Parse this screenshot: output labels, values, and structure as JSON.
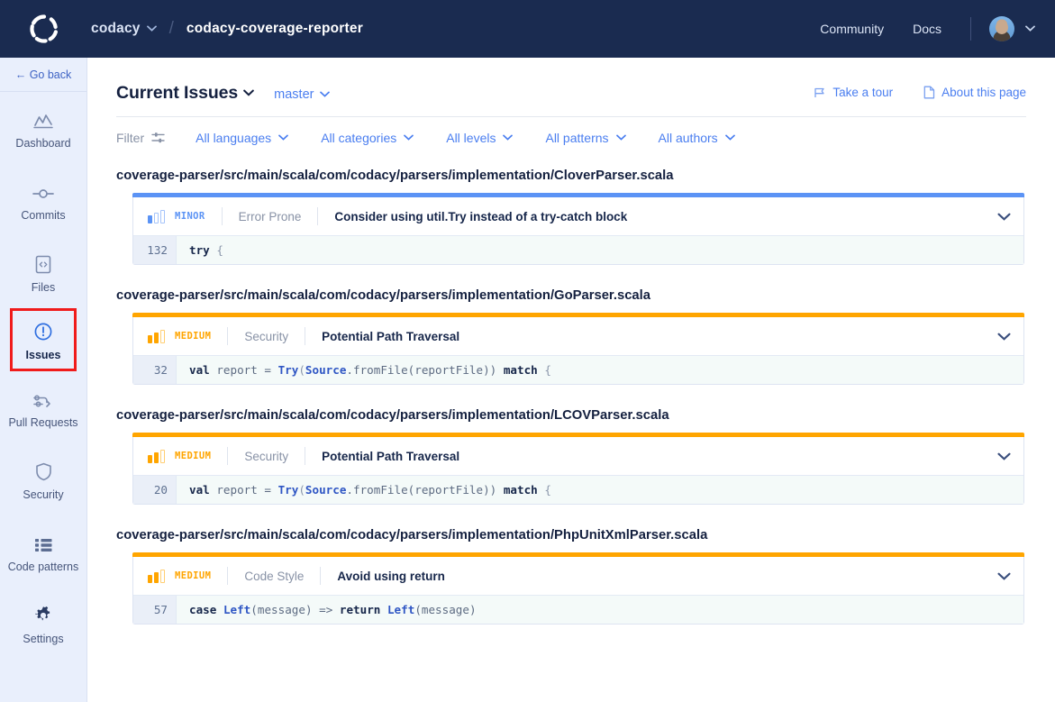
{
  "topbar": {
    "logo_icon": "codacy-logo-icon",
    "org": "codacy",
    "separator": "/",
    "repo": "codacy-coverage-reporter",
    "community": "Community",
    "docs": "Docs",
    "avatar_icon": "user-avatar",
    "user_caret_icon": "chevron-down-icon"
  },
  "sidebar": {
    "go_back": "← Go back",
    "items": [
      {
        "label": "Dashboard",
        "icon": "chart-line-icon",
        "active": false
      },
      {
        "label": "Commits",
        "icon": "commit-node-icon",
        "active": false
      },
      {
        "label": "Files",
        "icon": "file-code-icon",
        "active": false
      },
      {
        "label": "Issues",
        "icon": "alert-circle-icon",
        "active": true
      },
      {
        "label": "Pull Requests",
        "icon": "pull-request-icon",
        "active": false
      },
      {
        "label": "Security",
        "icon": "shield-icon",
        "active": false
      },
      {
        "label": "Code patterns",
        "icon": "list-icon",
        "active": false
      },
      {
        "label": "Settings",
        "icon": "gear-icon",
        "active": false
      }
    ]
  },
  "page": {
    "title": "Current Issues",
    "title_caret_icon": "chevron-down-icon",
    "branch": "master",
    "branch_caret_icon": "chevron-down-icon",
    "take_a_tour": "Take a tour",
    "take_a_tour_icon": "flag-icon",
    "about_this_page": "About this page",
    "about_this_page_icon": "document-icon"
  },
  "filters": {
    "label": "Filter",
    "label_icon": "sliders-icon",
    "items": [
      {
        "label": "All languages",
        "caret_icon": "chevron-down-icon"
      },
      {
        "label": "All categories",
        "caret_icon": "chevron-down-icon"
      },
      {
        "label": "All levels",
        "caret_icon": "chevron-down-icon"
      },
      {
        "label": "All patterns",
        "caret_icon": "chevron-down-icon"
      },
      {
        "label": "All authors",
        "caret_icon": "chevron-down-icon"
      }
    ]
  },
  "colors": {
    "minor": "#5b93f5",
    "medium": "#ffa500",
    "header_bg": "#1a2b50",
    "sidebar_bg": "#e9effc",
    "link": "#4a7ef0",
    "highlight_box": "#f01b1b"
  },
  "groups": [
    {
      "filepath": "coverage-parser/src/main/scala/com/codacy/parsers/implementation/CloverParser.scala",
      "issue": {
        "severity": "MINOR",
        "severity_level": 1,
        "severity_color": "#5b93f5",
        "category": "Error Prone",
        "title": "Consider using util.Try instead of a try-catch block",
        "expand_icon": "chevron-down-icon",
        "line_number": "132",
        "code_tokens": [
          {
            "t": "try",
            "c": "kw"
          },
          {
            "t": " ",
            "c": ""
          },
          {
            "t": "{",
            "c": "pn"
          }
        ]
      }
    },
    {
      "filepath": "coverage-parser/src/main/scala/com/codacy/parsers/implementation/GoParser.scala",
      "issue": {
        "severity": "MEDIUM",
        "severity_level": 2,
        "severity_color": "#ffa500",
        "category": "Security",
        "title": "Potential Path Traversal",
        "expand_icon": "chevron-down-icon",
        "line_number": "32",
        "code_tokens": [
          {
            "t": "val",
            "c": "kw"
          },
          {
            "t": " report = ",
            "c": ""
          },
          {
            "t": "Try",
            "c": "ty"
          },
          {
            "t": "(",
            "c": "pn"
          },
          {
            "t": "Source",
            "c": "ty"
          },
          {
            "t": ".fromFile(reportFile))",
            "c": ""
          },
          {
            "t": " ",
            "c": ""
          },
          {
            "t": "match",
            "c": "kw"
          },
          {
            "t": " ",
            "c": ""
          },
          {
            "t": "{",
            "c": "pn"
          }
        ]
      }
    },
    {
      "filepath": "coverage-parser/src/main/scala/com/codacy/parsers/implementation/LCOVParser.scala",
      "issue": {
        "severity": "MEDIUM",
        "severity_level": 2,
        "severity_color": "#ffa500",
        "category": "Security",
        "title": "Potential Path Traversal",
        "expand_icon": "chevron-down-icon",
        "line_number": "20",
        "code_tokens": [
          {
            "t": "val",
            "c": "kw"
          },
          {
            "t": " report = ",
            "c": ""
          },
          {
            "t": "Try",
            "c": "ty"
          },
          {
            "t": "(",
            "c": "pn"
          },
          {
            "t": "Source",
            "c": "ty"
          },
          {
            "t": ".fromFile(reportFile))",
            "c": ""
          },
          {
            "t": " ",
            "c": ""
          },
          {
            "t": "match",
            "c": "kw"
          },
          {
            "t": " ",
            "c": ""
          },
          {
            "t": "{",
            "c": "pn"
          }
        ]
      }
    },
    {
      "filepath": "coverage-parser/src/main/scala/com/codacy/parsers/implementation/PhpUnitXmlParser.scala",
      "issue": {
        "severity": "MEDIUM",
        "severity_level": 2,
        "severity_color": "#ffa500",
        "category": "Code Style",
        "title": "Avoid using return",
        "expand_icon": "chevron-down-icon",
        "line_number": "57",
        "code_tokens": [
          {
            "t": "case",
            "c": "kw"
          },
          {
            "t": " ",
            "c": ""
          },
          {
            "t": "Left",
            "c": "ty"
          },
          {
            "t": "(message)",
            "c": ""
          },
          {
            "t": " => ",
            "c": ""
          },
          {
            "t": "return",
            "c": "kw"
          },
          {
            "t": " ",
            "c": ""
          },
          {
            "t": "Left",
            "c": "ty"
          },
          {
            "t": "(message)",
            "c": ""
          }
        ]
      }
    }
  ]
}
